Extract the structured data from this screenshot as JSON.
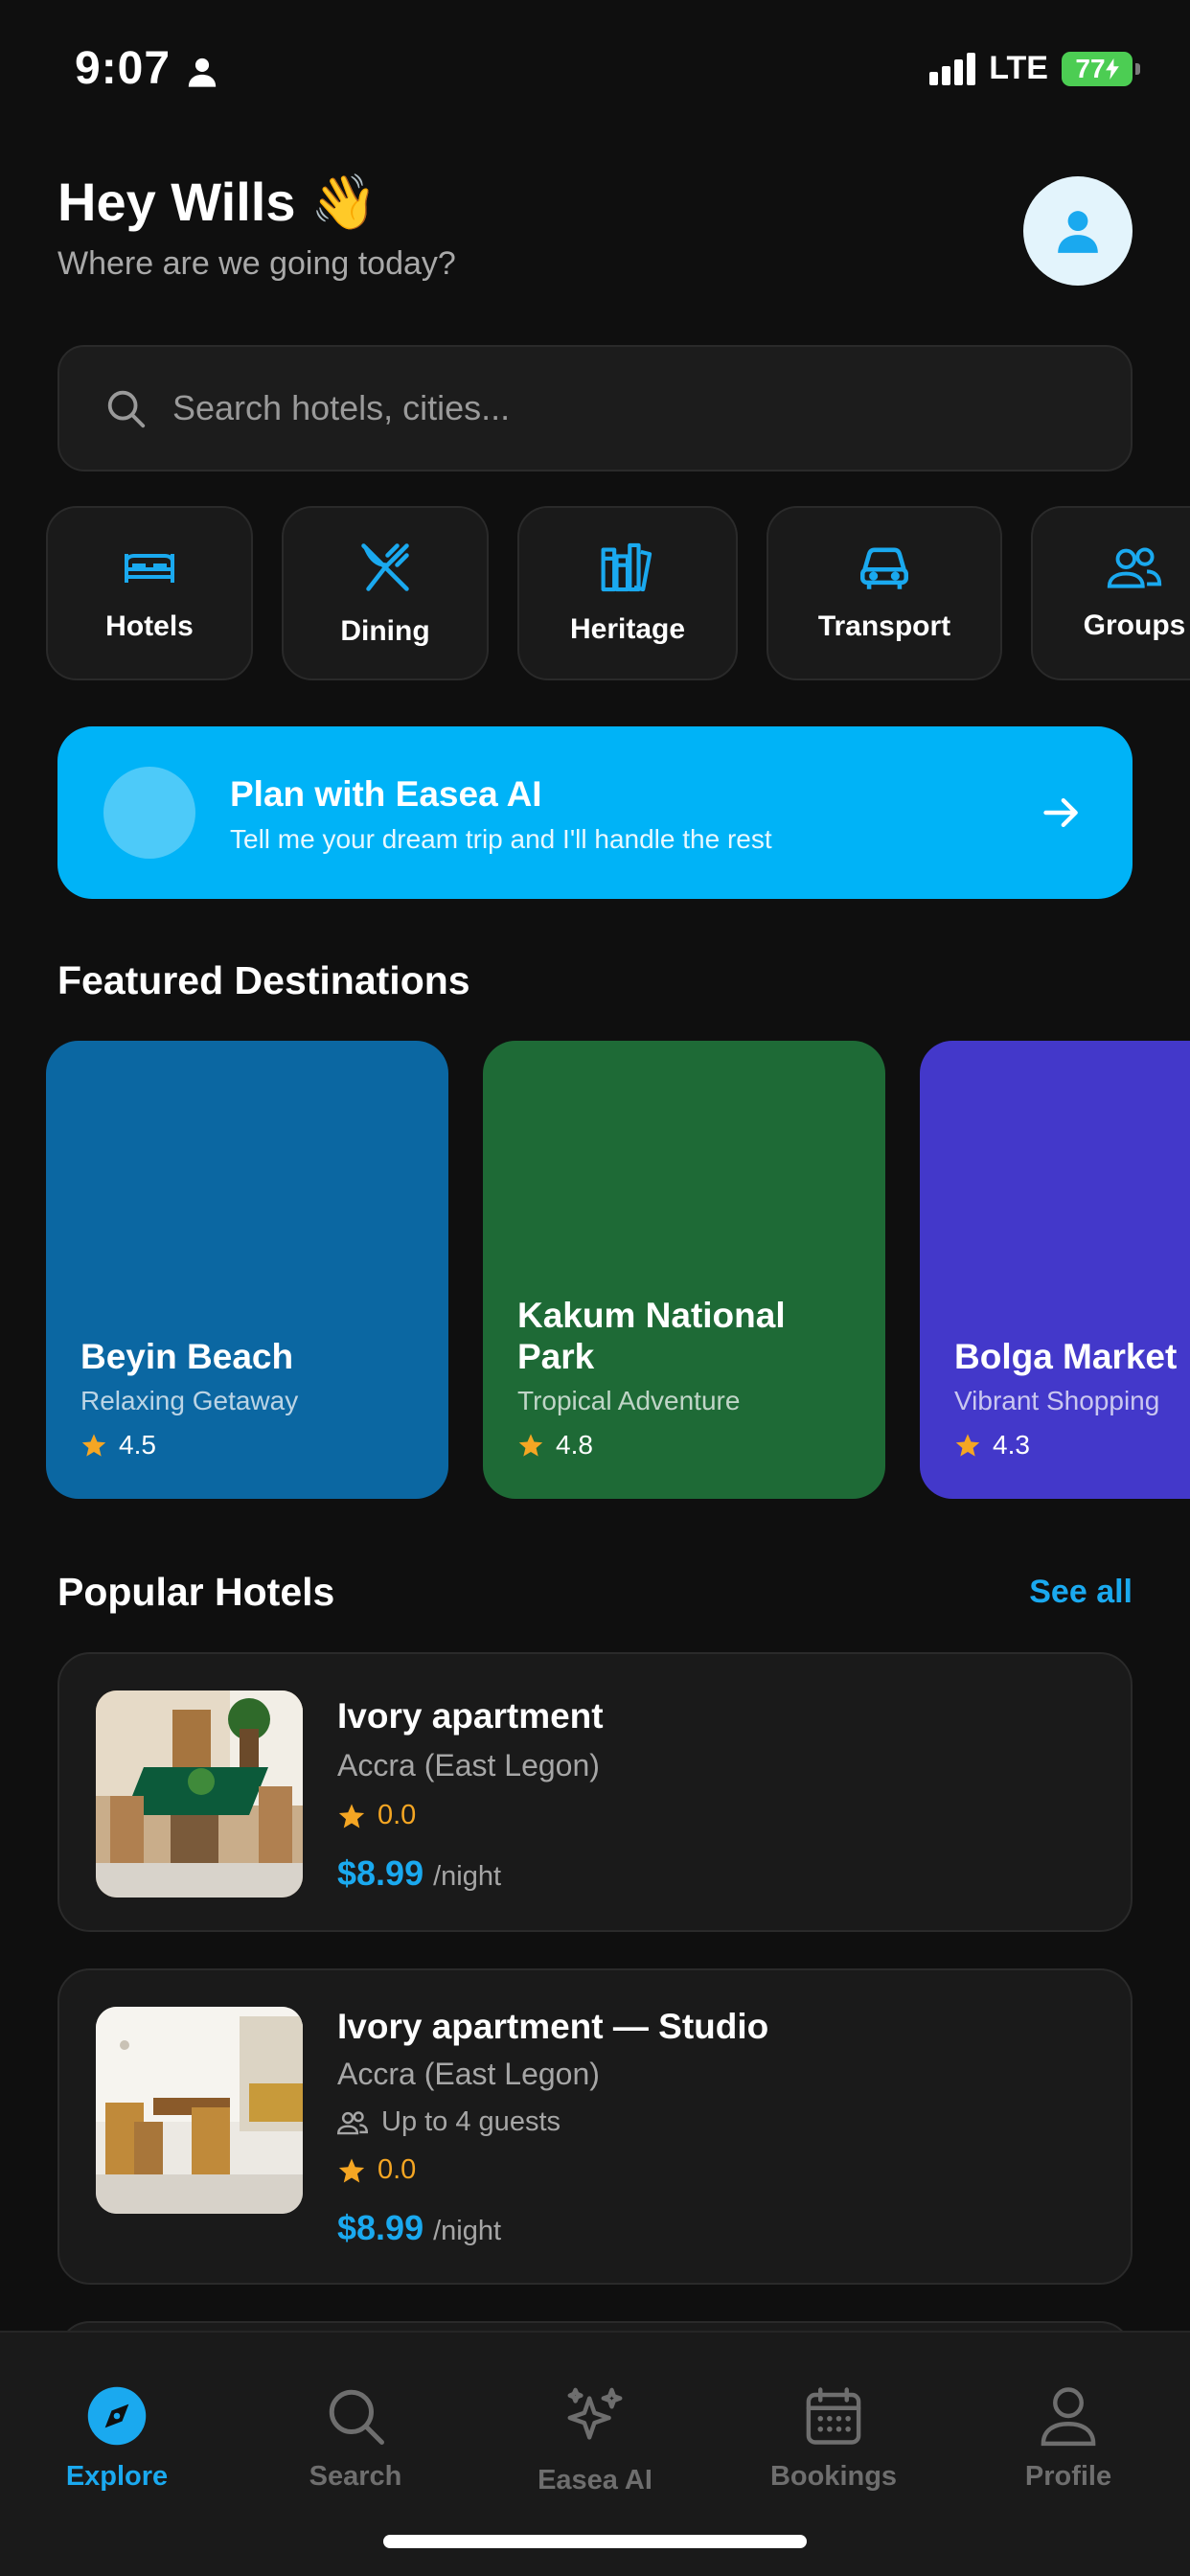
{
  "status_bar": {
    "time": "9:07",
    "network": "LTE",
    "battery": "77"
  },
  "header": {
    "greeting": "Hey Wills 👋",
    "subtitle": "Where are we going today?"
  },
  "search": {
    "placeholder": "Search hotels, cities..."
  },
  "categories": [
    {
      "label": "Hotels",
      "icon": "bed-icon"
    },
    {
      "label": "Dining",
      "icon": "fork-knife-icon"
    },
    {
      "label": "Heritage",
      "icon": "books-icon"
    },
    {
      "label": "Transport",
      "icon": "car-icon"
    },
    {
      "label": "Groups",
      "icon": "users-icon"
    }
  ],
  "ai_banner": {
    "title": "Plan with Easea AI",
    "subtitle": "Tell me your dream trip and I'll handle the rest"
  },
  "featured": {
    "title": "Featured Destinations",
    "items": [
      {
        "name": "Beyin Beach",
        "subtitle": "Relaxing Getaway",
        "rating": "4.5",
        "color": "#0b67a2"
      },
      {
        "name": "Kakum National Park",
        "name_line1": "Kakum National",
        "name_line2": "Park",
        "subtitle": "Tropical Adventure",
        "rating": "4.8",
        "color": "#1e6a36"
      },
      {
        "name": "Bolga Market",
        "subtitle": "Vibrant Shopping",
        "rating": "4.3",
        "color": "#4338ca"
      }
    ]
  },
  "popular": {
    "title": "Popular Hotels",
    "see_all": "See all",
    "items": [
      {
        "name": "Ivory apartment",
        "location": "Accra (East Legon)",
        "rating": "0.0",
        "price": "$8.99",
        "unit": "/night"
      },
      {
        "name": "Ivory apartment — Studio",
        "location": "Accra (East Legon)",
        "guests": "Up to 4 guests",
        "rating": "0.0",
        "price": "$8.99",
        "unit": "/night"
      }
    ]
  },
  "nav": [
    {
      "label": "Explore",
      "active": true
    },
    {
      "label": "Search"
    },
    {
      "label": "Easea AI"
    },
    {
      "label": "Bookings"
    },
    {
      "label": "Profile"
    }
  ],
  "colors": {
    "accent": "#1aa9ef",
    "banner": "#00b3f7",
    "star": "#f5a623",
    "background": "#0f0f0f",
    "card": "#1a1a1a"
  }
}
